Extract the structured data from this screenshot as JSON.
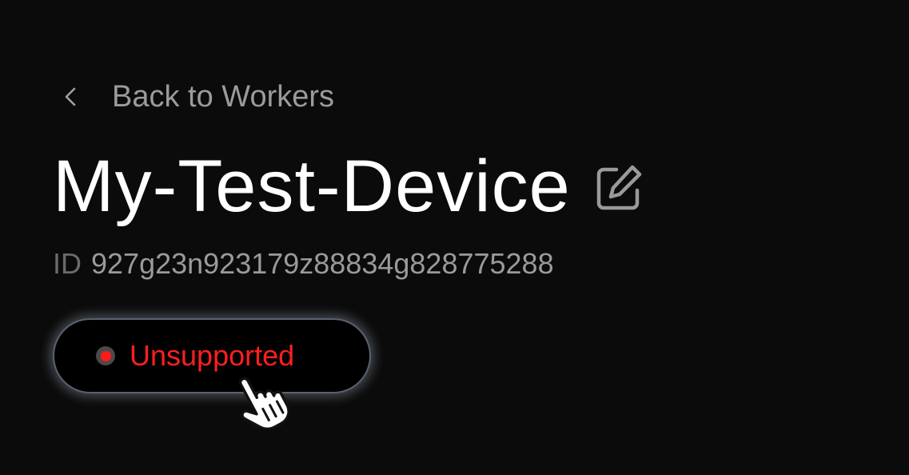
{
  "nav": {
    "back_label": "Back to Workers"
  },
  "device": {
    "name": "My-Test-Device",
    "id_label": "ID",
    "id_value": "927g23n923179z88834g828775288"
  },
  "status": {
    "label": "Unsupported",
    "color": "#ff1f1f"
  },
  "icons": {
    "back": "chevron-left-icon",
    "edit": "edit-icon",
    "cursor": "hand-pointer-cursor-icon"
  },
  "colors": {
    "background": "#0b0b0b",
    "text_primary": "#ffffff",
    "text_secondary": "#9b9b9b",
    "status_red": "#ff1f1f"
  }
}
